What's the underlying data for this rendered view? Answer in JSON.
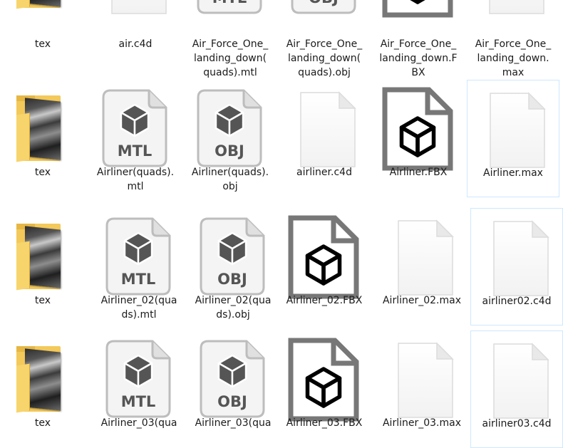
{
  "colors": {
    "selection_border": "#cde8ff",
    "folder": "#f3c95a",
    "badge": "#555555",
    "fbx_stroke": "#777777"
  },
  "rows": [
    {
      "items": [
        {
          "name": "tex",
          "type": "folder"
        },
        {
          "name": "air.c4d",
          "type": "blank"
        },
        {
          "name": "Air_Force_One_\nlanding_down(\nquads).mtl",
          "type": "mtl",
          "badge": "MTL"
        },
        {
          "name": "Air_Force_One_\nlanding_down(\nquads).obj",
          "type": "obj",
          "badge": "OBJ"
        },
        {
          "name": "Air_Force_One_\nlanding_down.F\nBX",
          "type": "fbx"
        },
        {
          "name": "Air_Force_One_\nlanding_down.\nmax",
          "type": "blank"
        }
      ]
    },
    {
      "items": [
        {
          "name": "tex",
          "type": "folder"
        },
        {
          "name": "Airliner(quads).\nmtl",
          "type": "mtl",
          "badge": "MTL"
        },
        {
          "name": "Airliner(quads).\nobj",
          "type": "obj",
          "badge": "OBJ"
        },
        {
          "name": "airliner.c4d",
          "type": "blank"
        },
        {
          "name": "Airliner.FBX",
          "type": "fbx"
        },
        {
          "name": "Airliner.max",
          "type": "blank",
          "selected": true
        }
      ]
    },
    {
      "items": [
        {
          "name": "tex",
          "type": "folder"
        },
        {
          "name": "Airliner_02(qua\nds).mtl",
          "type": "mtl",
          "badge": "MTL"
        },
        {
          "name": "Airliner_02(qua\nds).obj",
          "type": "obj",
          "badge": "OBJ"
        },
        {
          "name": "Airliner_02.FBX",
          "type": "fbx"
        },
        {
          "name": "Airliner_02.max",
          "type": "blank"
        },
        {
          "name": "airliner02.c4d",
          "type": "blank",
          "selected": true
        }
      ]
    },
    {
      "items": [
        {
          "name": "tex",
          "type": "folder"
        },
        {
          "name": "Airliner_03(qua",
          "type": "mtl",
          "badge": "MTL"
        },
        {
          "name": "Airliner_03(qua",
          "type": "obj",
          "badge": "OBJ"
        },
        {
          "name": "Airliner_03.FBX",
          "type": "fbx"
        },
        {
          "name": "Airliner_03.max",
          "type": "blank"
        },
        {
          "name": "airliner03.c4d",
          "type": "blank",
          "selected": true
        }
      ]
    }
  ]
}
